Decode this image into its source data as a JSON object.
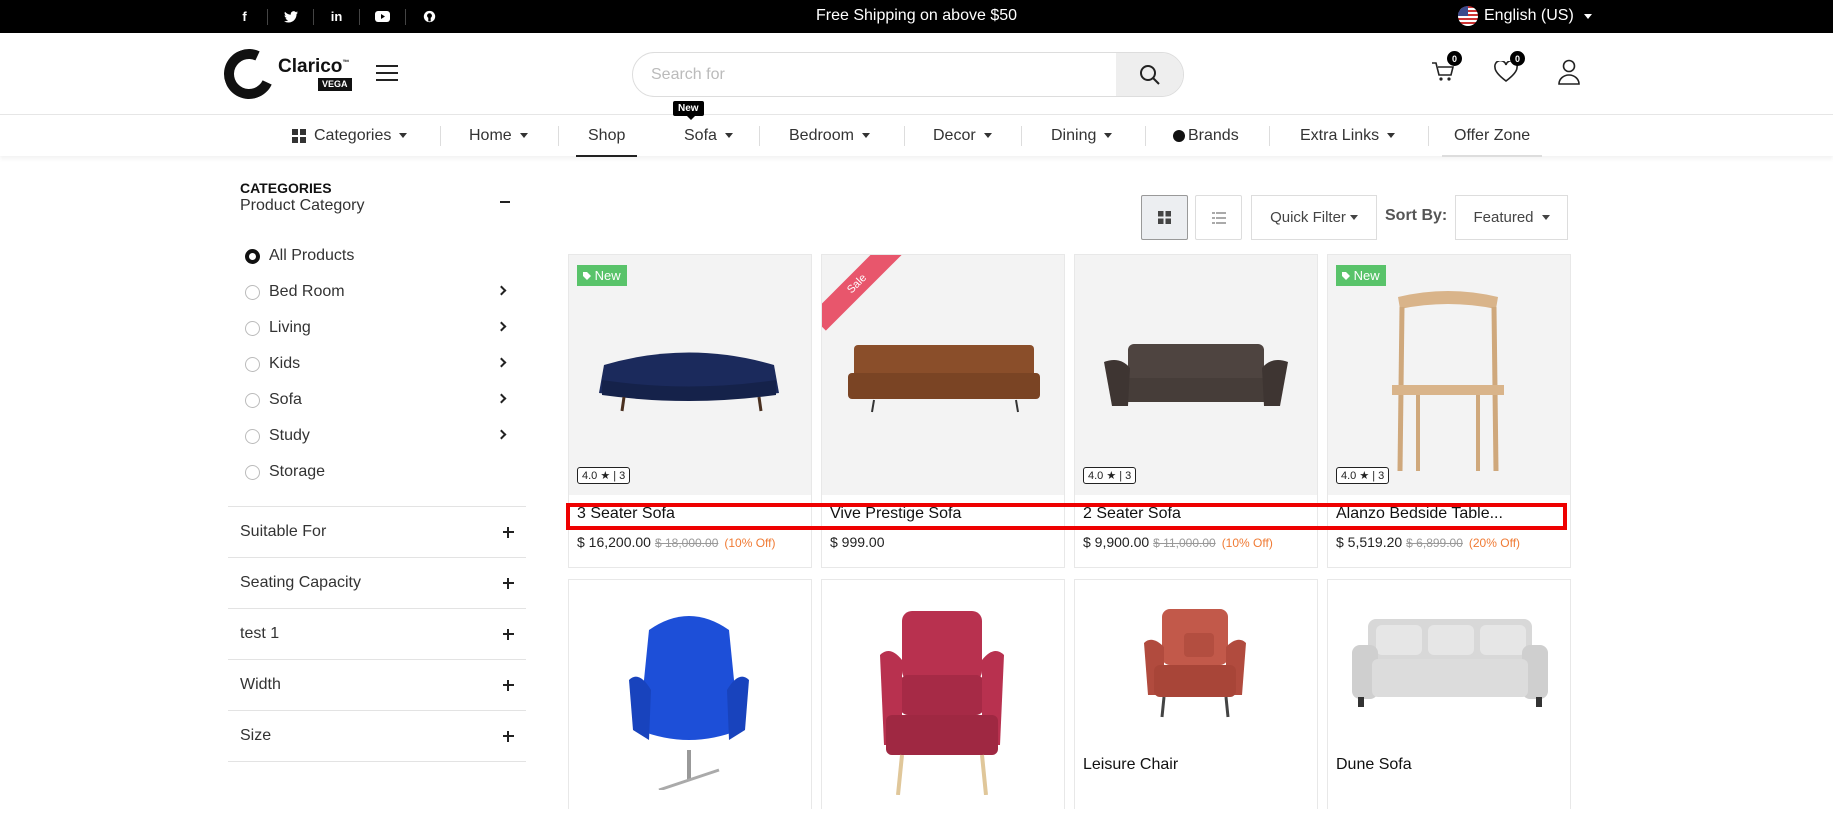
{
  "topbar": {
    "social": [
      "f",
      "t",
      "in",
      "yt",
      "gh"
    ],
    "promo": "Free Shipping on above $50",
    "language": "English (US)"
  },
  "header": {
    "logo": {
      "name": "Clarico",
      "tm": "™",
      "sub": "VEGA"
    },
    "search_placeholder": "Search for",
    "cart_count": "0",
    "wishlist_count": "0"
  },
  "nav": {
    "items": [
      "Categories",
      "Home",
      "Shop",
      "Sofa",
      "Bedroom",
      "Decor",
      "Dining",
      "Brands",
      "Extra Links",
      "Offer Zone"
    ],
    "new_tag": "New",
    "active": "Shop"
  },
  "sidebar": {
    "heading": "CATEGORIES",
    "subheading": "Product Category",
    "categories": [
      "All Products",
      "Bed Room",
      "Living",
      "Kids",
      "Sofa",
      "Study",
      "Storage"
    ],
    "selected": "All Products",
    "filters": [
      "Suitable For",
      "Seating Capacity",
      "test 1",
      "Width",
      "Size"
    ]
  },
  "toolbar": {
    "quick_filter": "Quick Filter",
    "sort_by_label": "Sort By:",
    "sort_value": "Featured"
  },
  "products": [
    {
      "name": "3 Seater Sofa",
      "price": "$ 16,200.00",
      "old_price": "$ 18,000.00",
      "discount": "(10% Off)",
      "rating": "4.0 ★ | 3",
      "tag": "New"
    },
    {
      "name": "Vive Prestige Sofa",
      "price": "$ 999.00",
      "old_price": "",
      "discount": "",
      "rating": "",
      "tag": "Sale"
    },
    {
      "name": "2 Seater Sofa",
      "price": "$ 9,900.00",
      "old_price": "$ 11,000.00",
      "discount": "(10% Off)",
      "rating": "4.0 ★ | 3",
      "tag": ""
    },
    {
      "name": "Alanzo Bedside Table...",
      "price": "$ 5,519.20",
      "old_price": "$ 6,899.00",
      "discount": "(20% Off)",
      "rating": "4.0 ★ | 3",
      "tag": "New"
    },
    {
      "name": "",
      "price": ""
    },
    {
      "name": "",
      "price": ""
    },
    {
      "name": "Leisure Chair",
      "price": ""
    },
    {
      "name": "Dune Sofa",
      "price": ""
    }
  ],
  "colors": {
    "accent": "#000000",
    "new_tag": "#59c36a",
    "sale_ribbon": "#e8566c",
    "discount": "#f07b35",
    "highlight": "#ee0000"
  }
}
